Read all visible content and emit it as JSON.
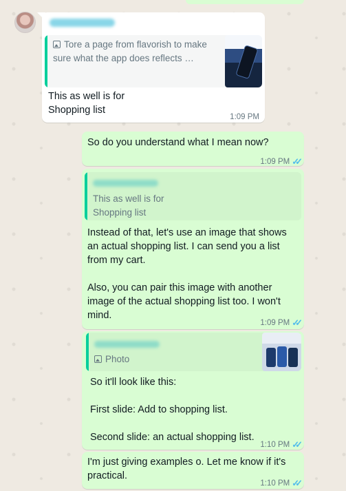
{
  "messages": [
    {
      "id": "m1",
      "reply_preview": "Tore a page from flavorish to make sure what the app does reflects …",
      "text": "This as well is for\nShopping list",
      "time": "1:09 PM"
    },
    {
      "id": "m2",
      "text": "So do you understand what I mean now?",
      "time": "1:09 PM"
    },
    {
      "id": "m3",
      "reply_preview": "This as well is for\nShopping list",
      "text": "Instead of that, let's use an image that shows an actual shopping list. I can send you a list from my cart.\n\nAlso, you can pair this image with another image of the actual shopping list too. I won't mind.",
      "time": "1:09 PM"
    },
    {
      "id": "m4",
      "reply_preview": "Photo",
      "text": "So it'll look like this:\n\nFirst slide: Add to shopping list.\n\nSecond slide: an actual shopping list.",
      "time": "1:10 PM"
    },
    {
      "id": "m5",
      "text": "I'm just giving examples o. Let me know if it's practical.",
      "time": "1:10 PM"
    }
  ],
  "colors": {
    "incoming_bubble": "#ffffff",
    "outgoing_bubble": "#d9fdd3",
    "read_ticks": "#53bdeb",
    "quote_bar": "#06cf9c"
  },
  "icons": {
    "ticks": "✓✓"
  }
}
